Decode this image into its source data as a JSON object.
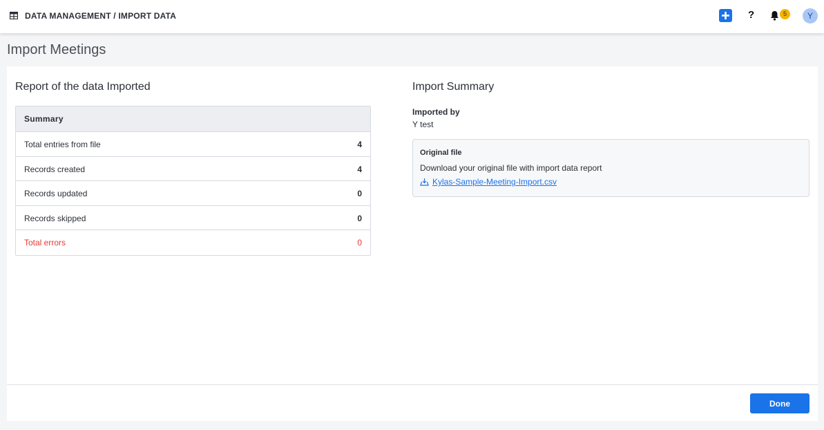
{
  "header": {
    "breadcrumb": "DATA MANAGEMENT / IMPORT DATA",
    "breadcrumb_icon": "table-grid-icon",
    "add_icon": "plus-icon",
    "help_label": "?",
    "notification_count": "5",
    "avatar_initial": "Y"
  },
  "page": {
    "title": "Import Meetings"
  },
  "report": {
    "title": "Report of the data Imported",
    "table_header": "Summary",
    "rows": [
      {
        "label": "Total entries from file",
        "value": "4"
      },
      {
        "label": "Records created",
        "value": "4"
      },
      {
        "label": "Records updated",
        "value": "0"
      },
      {
        "label": "Records skipped",
        "value": "0"
      },
      {
        "label": "Total errors",
        "value": "0"
      }
    ]
  },
  "import_summary": {
    "title": "Import Summary",
    "imported_by_label": "Imported by",
    "imported_by_value": "Y test",
    "original_file": {
      "title": "Original file",
      "description": "Download your original file with import data report",
      "file_name": "Kylas-Sample-Meeting-Import.csv",
      "icon": "download-icon"
    }
  },
  "footer": {
    "done_label": "Done"
  },
  "colors": {
    "accent": "#1a73e8",
    "error": "#e53935",
    "badge": "#f5b400"
  }
}
